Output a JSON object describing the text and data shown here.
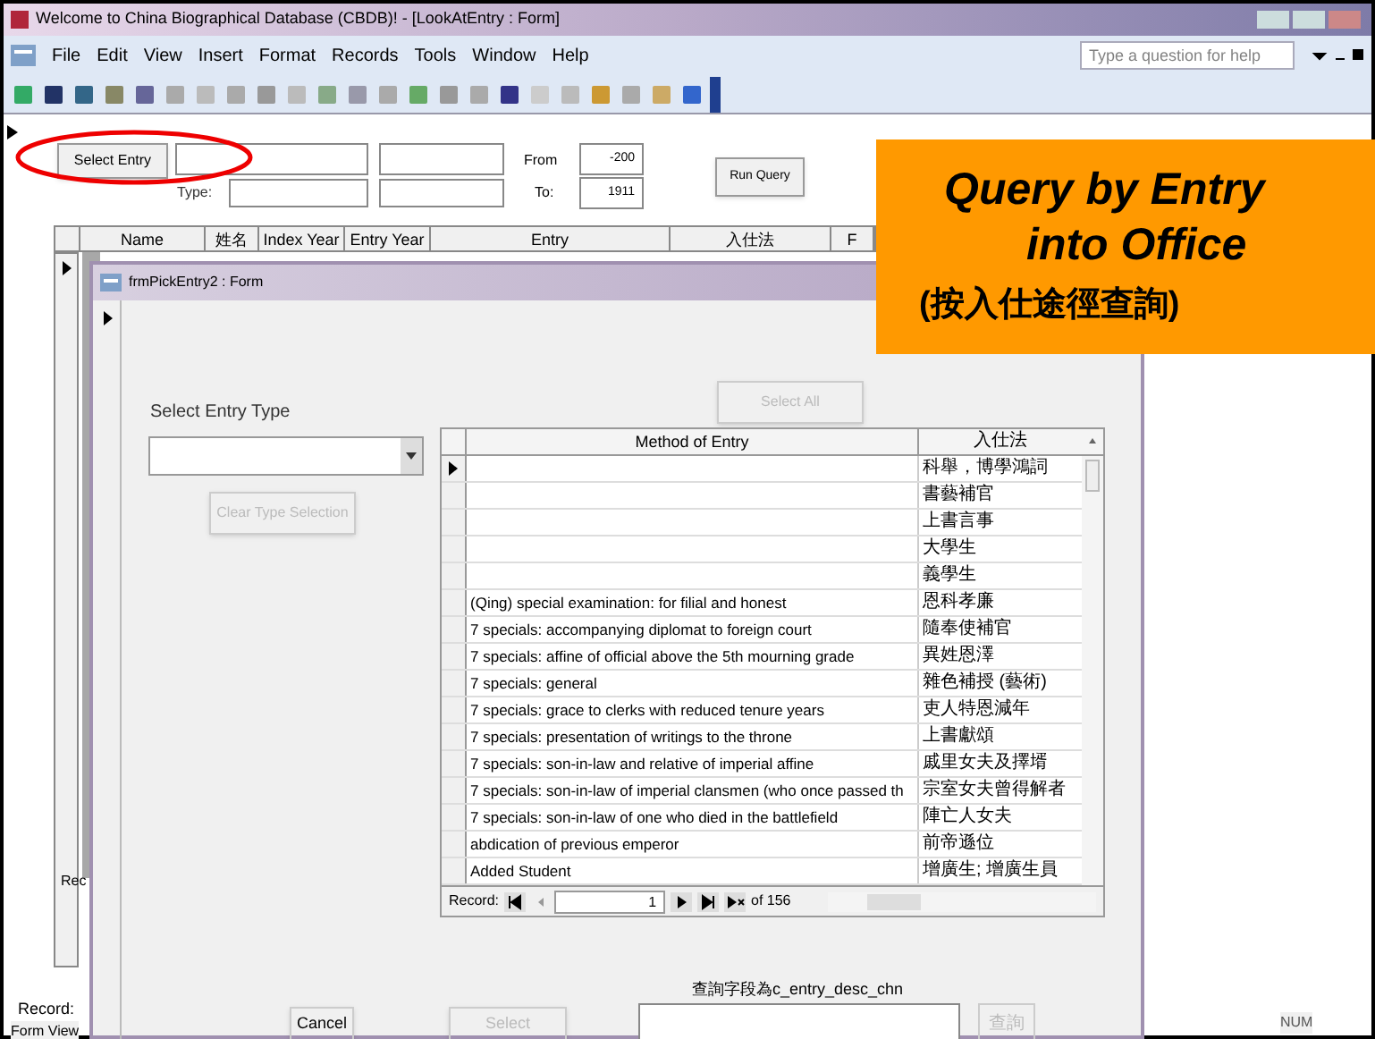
{
  "window": {
    "title": "Welcome to China Biographical Database (CBDB)! - [LookAtEntry : Form]"
  },
  "menu": [
    "File",
    "Edit",
    "View",
    "Insert",
    "Format",
    "Records",
    "Tools",
    "Window",
    "Help"
  ],
  "help_box": {
    "placeholder": "Type a question for help"
  },
  "form": {
    "select_entry_button": "Select Entry",
    "type_label": "Type:",
    "from_label": "From",
    "from_value": "-200",
    "to_label": "To:",
    "to_value": "1911",
    "run_query_button": "Run Query",
    "columns": [
      "Name",
      "姓名",
      "Index Year",
      "Entry Year",
      "Entry",
      "入仕法",
      "F"
    ],
    "subform_record_label": "Rec",
    "record_label": "Record:",
    "view_label": "Form View",
    "status": "NUM"
  },
  "dialog": {
    "title": "frmPickEntry2 : Form",
    "select_entry_type_label": "Select Entry Type",
    "clear_button": {
      "label": "Clear Type Selection",
      "disabled": true
    },
    "select_all_button": {
      "label": "Select All",
      "disabled": true
    },
    "columns": [
      "Method of Entry",
      "入仕法"
    ],
    "rows": [
      {
        "method": "",
        "chinese": "科舉，博學鴻詞",
        "selected": true
      },
      {
        "method": "",
        "chinese": "書藝補官",
        "selected": false
      },
      {
        "method": "",
        "chinese": "上書言事",
        "selected": false
      },
      {
        "method": "",
        "chinese": "大學生",
        "selected": false
      },
      {
        "method": "",
        "chinese": "義學生",
        "selected": false
      },
      {
        "method": "(Qing) special examination: for filial and honest",
        "chinese": "恩科孝廉",
        "selected": false
      },
      {
        "method": "7 specials: accompanying diplomat to foreign court",
        "chinese": "隨奉使補官",
        "selected": false
      },
      {
        "method": "7 specials: affine of official above the 5th mourning grade",
        "chinese": "異姓恩澤",
        "selected": false
      },
      {
        "method": "7 specials: general",
        "chinese": "雜色補授 (藝術)",
        "selected": false
      },
      {
        "method": "7 specials: grace to clerks with reduced tenure years",
        "chinese": "吏人特恩減年",
        "selected": false
      },
      {
        "method": "7 specials: presentation of writings to the throne",
        "chinese": "上書獻頌",
        "selected": false
      },
      {
        "method": "7 specials: son-in-law and relative of imperial affine",
        "chinese": "戚里女夫及擇壻",
        "selected": false
      },
      {
        "method": "7 specials: son-in-law of imperial clansmen (who once passed th",
        "chinese": "宗室女夫曾得解者",
        "selected": false
      },
      {
        "method": "7 specials: son-in-law of one who died in the battlefield",
        "chinese": "陣亡人女夫",
        "selected": false
      },
      {
        "method": "abdication of previous emperor",
        "chinese": "前帝遜位",
        "selected": false
      },
      {
        "method": "Added Student",
        "chinese": "增廣生; 增廣生員",
        "selected": false
      }
    ],
    "nav": {
      "label": "Record:",
      "current": "1",
      "total": "of 156"
    },
    "field_label": "查詢字段為c_entry_desc_chn",
    "buttons": [
      {
        "kind": "cancel",
        "label": "Cancel",
        "disabled": false
      },
      {
        "kind": "select",
        "label": "Select",
        "disabled": true
      }
    ],
    "query_button": {
      "label": "查詢",
      "disabled": true
    }
  },
  "callout": {
    "lines": [
      "Query by Entry",
      "into Office"
    ],
    "subtitle": "(按入仕途徑查詢)"
  }
}
